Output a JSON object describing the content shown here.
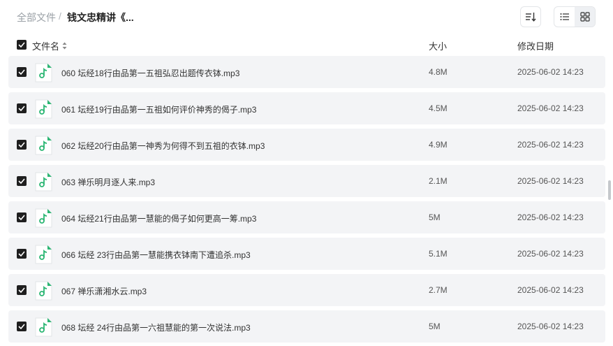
{
  "breadcrumb": {
    "root": "全部文件",
    "separator": "/",
    "current": "钱文忠精讲《..."
  },
  "toolbar": {
    "sort_icon": "sort-icon",
    "list_view_icon": "list-view-icon",
    "grid_view_icon": "grid-view-icon",
    "active_view": "list"
  },
  "table": {
    "headers": {
      "name": "文件名",
      "size": "大小",
      "date": "修改日期"
    },
    "all_selected": true,
    "rows": [
      {
        "name": "060 坛经18行由品第一五祖弘忍出题传衣钵.mp3",
        "size": "4.8M",
        "date": "2025-06-02 14:23",
        "selected": true,
        "icon": "audio-file-icon"
      },
      {
        "name": "061 坛经19行由品第一五祖如何评价神秀的偈子.mp3",
        "size": "4.5M",
        "date": "2025-06-02 14:23",
        "selected": true,
        "icon": "audio-file-icon"
      },
      {
        "name": "062 坛经20行由品第一神秀为何得不到五祖的衣钵.mp3",
        "size": "4.9M",
        "date": "2025-06-02 14:23",
        "selected": true,
        "icon": "audio-file-icon"
      },
      {
        "name": "063 禅乐明月逐人来.mp3",
        "size": "2.1M",
        "date": "2025-06-02 14:23",
        "selected": true,
        "icon": "audio-file-icon"
      },
      {
        "name": "064 坛经21行由品第一慧能的偈子如何更高一筹.mp3",
        "size": "5M",
        "date": "2025-06-02 14:23",
        "selected": true,
        "icon": "audio-file-icon"
      },
      {
        "name": "066 坛经 23行由品第一慧能携衣钵南下遭追杀.mp3",
        "size": "5.1M",
        "date": "2025-06-02 14:23",
        "selected": true,
        "icon": "audio-file-icon"
      },
      {
        "name": "067 禅乐潇湘水云.mp3",
        "size": "2.7M",
        "date": "2025-06-02 14:23",
        "selected": true,
        "icon": "audio-file-icon"
      },
      {
        "name": "068 坛经 24行由品第一六祖慧能的第一次说法.mp3",
        "size": "5M",
        "date": "2025-06-02 14:23",
        "selected": true,
        "icon": "audio-file-icon"
      }
    ]
  },
  "colors": {
    "row_background": "#f3f4f6",
    "checkbox": "#1f1f1f",
    "audio_icon": "#2bb673"
  }
}
